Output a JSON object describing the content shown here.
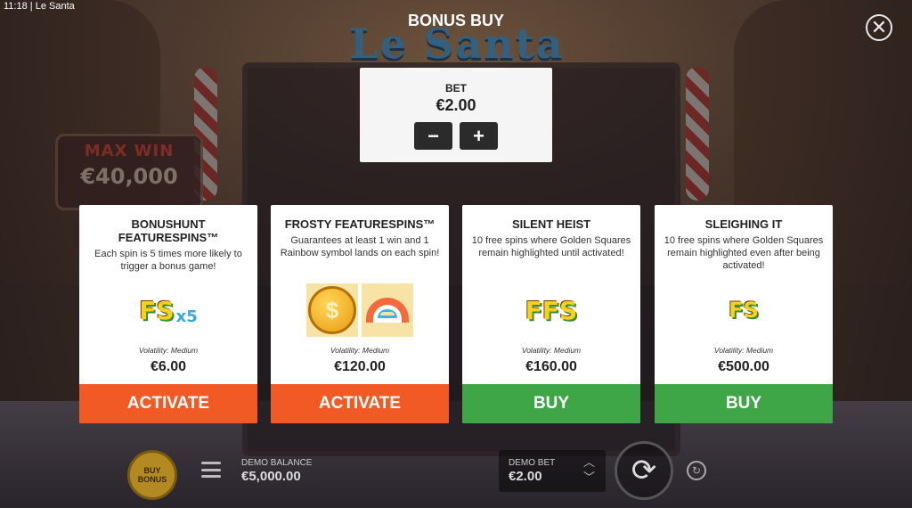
{
  "status_bar": {
    "time": "11:18",
    "app": "Le Santa"
  },
  "modal": {
    "title": "BONUS BUY"
  },
  "game": {
    "logo": "Le Santa",
    "max_win_title": "MAX WIN",
    "max_win_value": "€40,000"
  },
  "bet": {
    "label": "BET",
    "value": "€2.00",
    "decrease": "−",
    "increase": "+"
  },
  "cards": [
    {
      "title": "BONUSHUNT FEATURESPINS™",
      "description": "Each spin is 5 times more likely to trigger a bonus game!",
      "art_text": "FS",
      "art_multiplier": "x5",
      "volatility": "Volatility: Medium",
      "price": "€6.00",
      "button": "ACTIVATE"
    },
    {
      "title": "FROSTY FEATURESPINS™",
      "description": "Guarantees at least 1 win and 1 Rainbow symbol lands on each spin!",
      "art_text": "$",
      "volatility": "Volatility: Medium",
      "price": "€120.00",
      "button": "ACTIVATE"
    },
    {
      "title": "SILENT HEIST",
      "description": "10 free spins where Golden Squares remain highlighted until activated!",
      "art_text": "FFS",
      "volatility": "Volatility: Medium",
      "price": "€160.00",
      "button": "BUY"
    },
    {
      "title": "SLEIGHING IT",
      "description": "10 free spins where Golden Squares remain highlighted even after being activated!",
      "art_text": "FS",
      "volatility": "Volatility: Medium",
      "price": "€500.00",
      "button": "BUY"
    }
  ],
  "footer": {
    "buy_bonus": "BUY BONUS",
    "demo_balance_label": "DEMO BALANCE",
    "demo_balance_value": "€5,000.00",
    "demo_bet_label": "DEMO BET",
    "demo_bet_value": "€2.00"
  },
  "colors": {
    "activate": "#f15a24",
    "buy": "#3fa648"
  },
  "icons": {
    "close": "close-icon",
    "menu": "menu-icon",
    "spin": "spin-icon",
    "autoplay": "autoplay-icon"
  }
}
